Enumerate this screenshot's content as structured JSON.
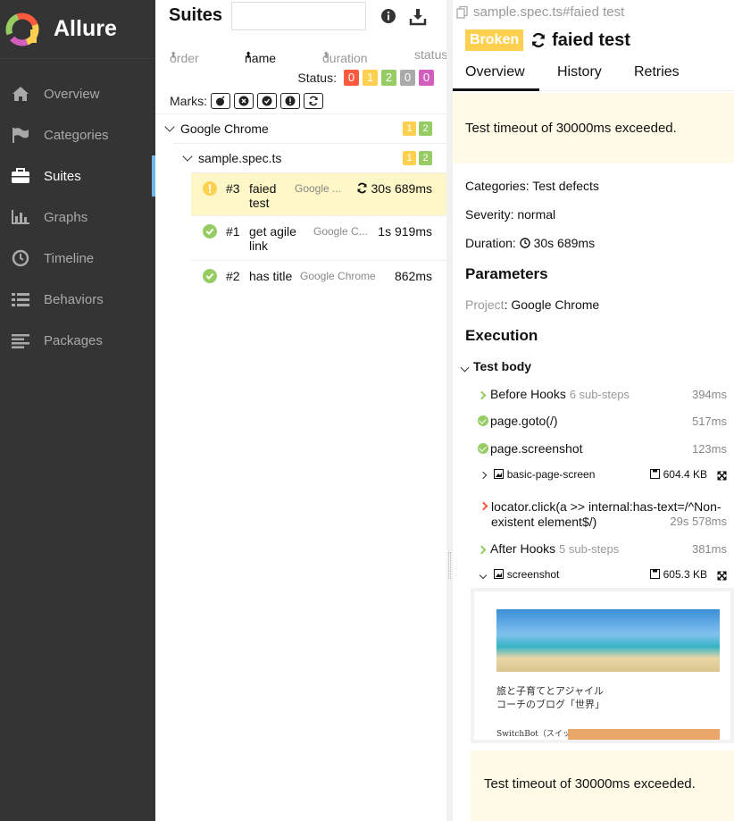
{
  "app": {
    "title": "Allure"
  },
  "sidebar": {
    "items": [
      {
        "label": "Overview",
        "icon": "home-icon"
      },
      {
        "label": "Categories",
        "icon": "flag-icon"
      },
      {
        "label": "Suites",
        "icon": "briefcase-icon",
        "active": true
      },
      {
        "label": "Graphs",
        "icon": "bar-chart-icon"
      },
      {
        "label": "Timeline",
        "icon": "clock-icon"
      },
      {
        "label": "Behaviors",
        "icon": "list-icon"
      },
      {
        "label": "Packages",
        "icon": "align-left-icon"
      }
    ]
  },
  "suites": {
    "title": "Suites",
    "search_value": "",
    "columns": {
      "order": "order",
      "name": "name",
      "duration": "duration",
      "status": "status"
    },
    "status_label": "Status:",
    "status_counts": {
      "failed": "0",
      "broken": "1",
      "passed": "2",
      "skipped": "0",
      "unknown": "0"
    },
    "marks_label": "Marks:",
    "tree": {
      "browser_group": {
        "label": "Google Chrome",
        "broken": "1",
        "passed": "2"
      },
      "spec_group": {
        "label": "sample.spec.ts",
        "broken": "1",
        "passed": "2"
      },
      "tests": [
        {
          "num": "#3",
          "name": "faied test",
          "browser": "Google ...",
          "duration": "30s 689ms",
          "status": "broken",
          "retried": true
        },
        {
          "num": "#1",
          "name": "get agile link",
          "browser": "Google C...",
          "duration": "1s 919ms",
          "status": "passed"
        },
        {
          "num": "#2",
          "name": "has title",
          "browser": "Google Chrome",
          "duration": "862ms",
          "status": "passed"
        }
      ]
    }
  },
  "detail": {
    "breadcrumb": "sample.spec.ts#faied test",
    "status": "Broken",
    "title": "faied test",
    "tabs": {
      "overview": "Overview",
      "history": "History",
      "retries": "Retries"
    },
    "error_message": "Test timeout of 30000ms exceeded.",
    "categories": "Categories: Test defects",
    "severity": "Severity: normal",
    "duration_label": "Duration:",
    "duration_value": "30s 689ms",
    "parameters_heading": "Parameters",
    "param_key": "Project",
    "param_value": ": Google Chrome",
    "execution_heading": "Execution",
    "test_body_label": "Test body",
    "steps": {
      "before_hooks": {
        "label": "Before Hooks",
        "note": "6 sub-steps",
        "duration": "394ms"
      },
      "goto": {
        "label": "page.goto(/)",
        "duration": "517ms"
      },
      "screenshot_step": {
        "label": "page.screenshot",
        "duration": "123ms"
      },
      "attachment1": {
        "label": "basic-page-screen",
        "size": "604.4 KB"
      },
      "locator": {
        "label_line1": "locator.click(a >> internal:has-text=/^Non-",
        "label_line2": "existent element$/)",
        "duration": "29s 578ms"
      },
      "after_hooks": {
        "label": "After Hooks",
        "note": "5 sub-steps",
        "duration": "381ms"
      },
      "attachment2": {
        "label": "screenshot",
        "size": "605.3 KB"
      }
    },
    "preview_title_line1": "旅と子育てとアジャイル",
    "preview_title_line2": "コーチのブログ「世界」",
    "preview_caption": "SwitchBot（スイッチボット）のスマー",
    "error_message_2": "Test timeout of 30000ms exceeded."
  }
}
